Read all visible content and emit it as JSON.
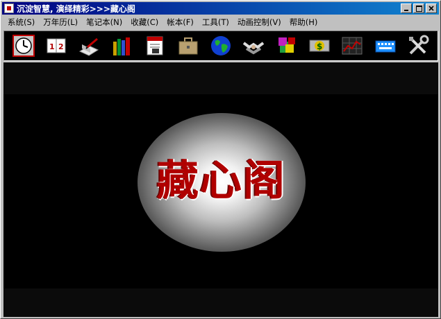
{
  "window": {
    "title": "沉淀智慧, 演绎精彩>>>藏心阁"
  },
  "menu": [
    {
      "label": "系统(S)"
    },
    {
      "label": "万年历(L)"
    },
    {
      "label": "笔记本(N)"
    },
    {
      "label": "收藏(C)"
    },
    {
      "label": "帐本(F)"
    },
    {
      "label": "工具(T)"
    },
    {
      "label": "动画控制(V)"
    },
    {
      "label": "帮助(H)"
    }
  ],
  "toolbar": [
    {
      "icon": "clock-icon"
    },
    {
      "icon": "calendar-icon"
    },
    {
      "icon": "notebook-icon"
    },
    {
      "icon": "books-icon"
    },
    {
      "icon": "document-icon"
    },
    {
      "icon": "briefcase-icon"
    },
    {
      "icon": "globe-icon"
    },
    {
      "icon": "handshake-icon"
    },
    {
      "icon": "puzzle-icon"
    },
    {
      "icon": "money-icon"
    },
    {
      "icon": "chart-icon"
    },
    {
      "icon": "keyboard-icon"
    },
    {
      "icon": "tools-icon"
    }
  ],
  "logo": {
    "text": "藏心阁",
    "color": "#b00000"
  },
  "colors": {
    "titlebar_start": "#000080",
    "titlebar_end": "#1084d0",
    "toolbar_bg": "#000000"
  }
}
